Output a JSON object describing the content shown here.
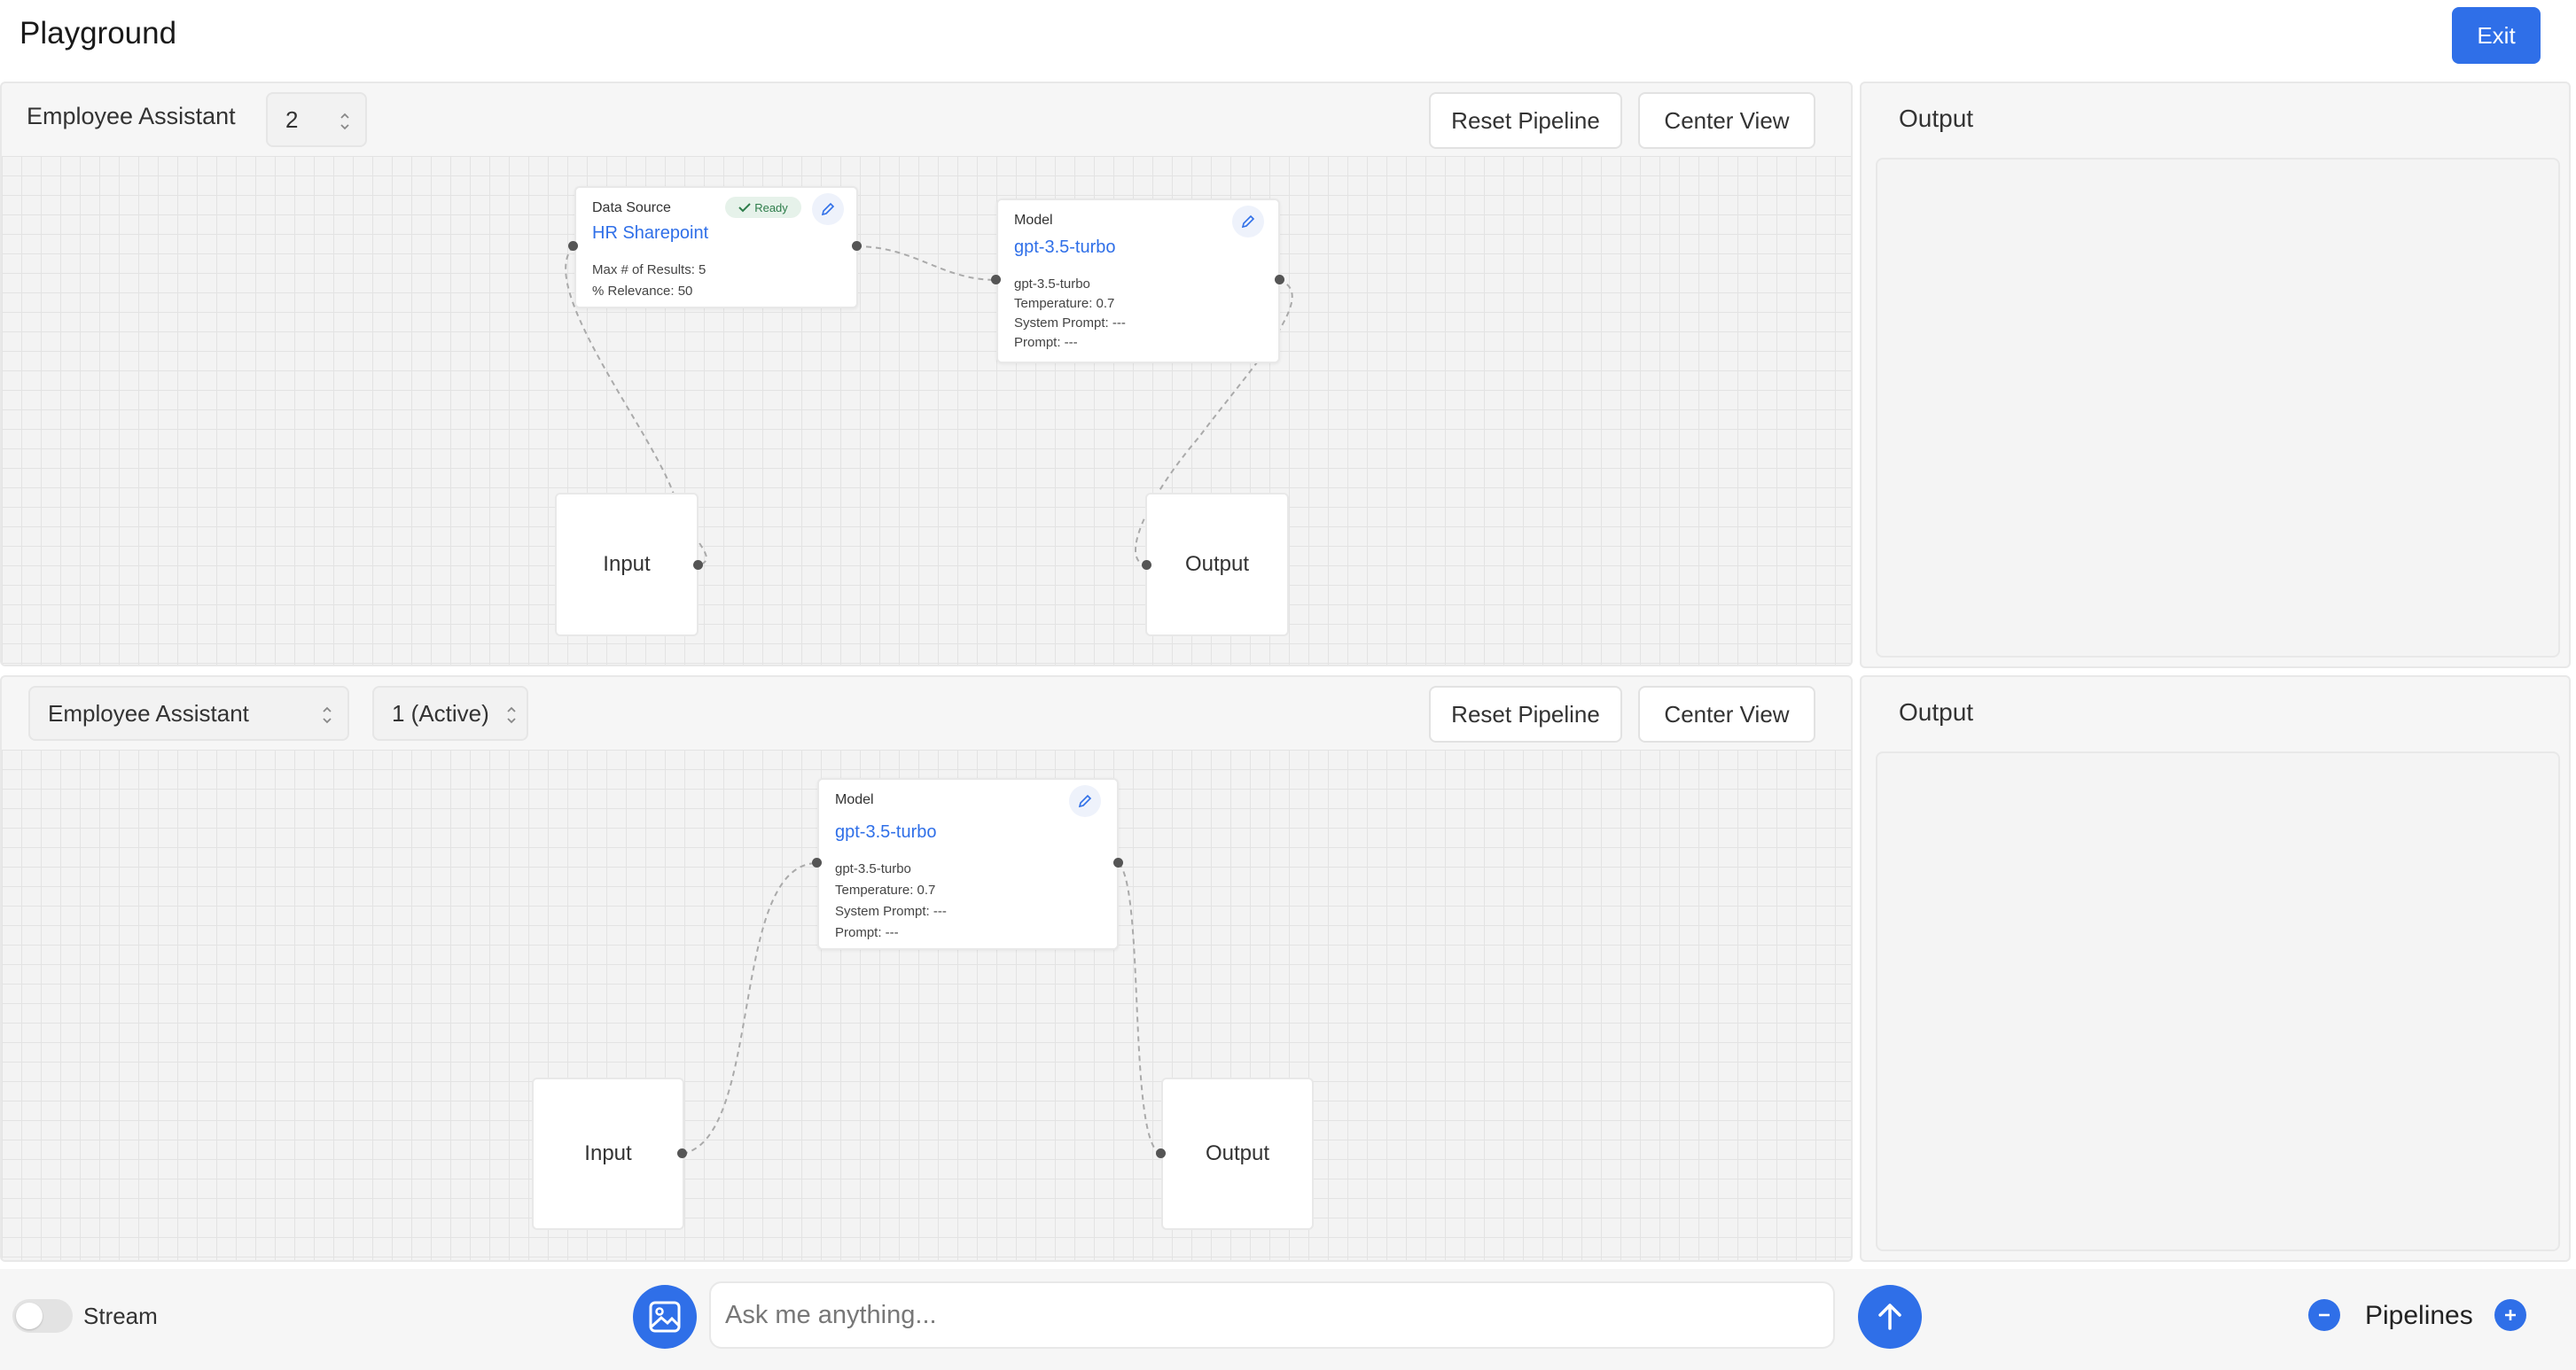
{
  "header": {
    "title": "Playground",
    "exit_label": "Exit"
  },
  "pipelines": [
    {
      "assistant_label": "Employee Assistant",
      "version_value": "2",
      "reset_label": "Reset Pipeline",
      "center_label": "Center View",
      "nodes": {
        "data_source": {
          "kind": "Data Source",
          "badge": "Ready",
          "title": "HR Sharepoint",
          "max_results": "Max # of Results: 5",
          "relevance": "% Relevance: 50"
        },
        "model": {
          "kind": "Model",
          "title": "gpt-3.5-turbo",
          "model_name": "gpt-3.5-turbo",
          "temperature": "Temperature: 0.7",
          "system_prompt": "System Prompt: ---",
          "prompt": "Prompt: ---"
        },
        "input": "Input",
        "output": "Output"
      },
      "output_title": "Output"
    },
    {
      "assistant_value": "Employee Assistant",
      "version_value": "1 (Active)",
      "reset_label": "Reset Pipeline",
      "center_label": "Center View",
      "nodes": {
        "model": {
          "kind": "Model",
          "title": "gpt-3.5-turbo",
          "model_name": "gpt-3.5-turbo",
          "temperature": "Temperature: 0.7",
          "system_prompt": "System Prompt: ---",
          "prompt": "Prompt: ---"
        },
        "input": "Input",
        "output": "Output"
      },
      "output_title": "Output"
    }
  ],
  "bottom_bar": {
    "stream_label": "Stream",
    "stream_on": false,
    "ask_placeholder": "Ask me anything...",
    "pipelines_label": "Pipelines"
  },
  "icons": {
    "upload_image": "image-icon",
    "send": "arrow-up-icon",
    "remove_pipeline": "minus-icon",
    "add_pipeline": "plus-icon",
    "edit": "pencil-icon",
    "ready": "check-icon",
    "select": "chevron-up-down-icon"
  },
  "colors": {
    "accent": "#2f6fe8",
    "ready_badge_bg": "#e6f2ea",
    "ready_badge_text": "#2e7d4b"
  }
}
